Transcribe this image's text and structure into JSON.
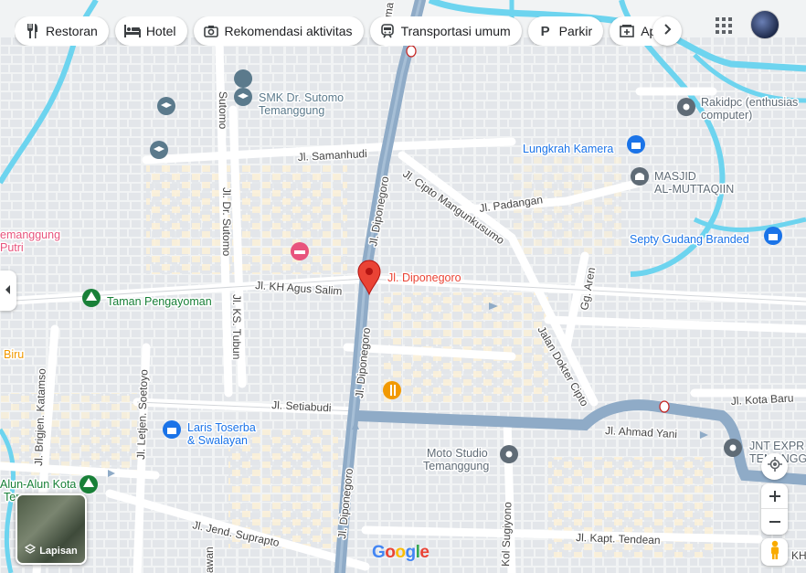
{
  "chips": [
    {
      "label": "Restoran",
      "icon": "fork-knife-icon"
    },
    {
      "label": "Hotel",
      "icon": "bed-icon"
    },
    {
      "label": "Rekomendasi aktivitas",
      "icon": "camera-icon"
    },
    {
      "label": "Transportasi umum",
      "icon": "train-icon"
    },
    {
      "label": "Parkir",
      "icon": "parking-icon"
    },
    {
      "label": "Apo",
      "icon": "pharmacy-icon"
    }
  ],
  "streets": {
    "ramaya": "Jl. Rama",
    "sutomo_top": "Sutomo",
    "samanhudi": "Jl. Samanhudi",
    "cipto_mangunkusumo": "Jl. Cipto Mangunkusumo",
    "padangan": "Jl. Padangan",
    "diponegoro_n": "Jl. Diponegoro",
    "dr_sutomo": "Jl. Dr. Sutomo",
    "kh_agus_salim": "Jl. KH Agus Salim",
    "ks_tubun": "Jl. KS. Tubun",
    "diponegoro_mid": "Jl. Diponegoro",
    "jalan_dokter_cipto": "Jalan Dokter Cipto",
    "gg_aren": "Gg. Aren",
    "brigjen_katamso": "Jl. Brigjen. Katamso",
    "letjen_soetoyo": "Jl. Letjen. Soetoyo",
    "setiabudi": "Jl. Setiabudi",
    "ahmad_yani": "Jl. Ahmad Yani",
    "kota_baru": "Jl. Kota Baru",
    "diponegoro_s": "Jl. Diponegoro",
    "kol_sugiyono": "Kol Sugiyono",
    "jend_suprapto": "Jl. Jend. Suprapto",
    "kapt_tendean": "Jl. Kapt. Tendean",
    "kh": "KH",
    "awan": "awan"
  },
  "pois": {
    "smk_sutomo_1": "SMK Dr. Sutomo",
    "smk_sutomo_2": "Temanggung",
    "rakidpc_1": "Rakidpc (enthusias",
    "rakidpc_2": "computer)",
    "lungkrah": "Lungkrah Kamera",
    "masjid_1": "MASJID",
    "masjid_2": "AL-MUTTAQIIN",
    "septy": "Septy Gudang Branded",
    "temanggung_left_1": "emanggung",
    "temanggung_left_2": "Putri",
    "taman": "Taman Pengayoman",
    "biru": "Biru",
    "selected_pin": "Jl. Diponegoro",
    "laris_1": "Laris Toserba",
    "laris_2": "& Swalayan",
    "moto_1": "Moto Studio",
    "moto_2": "Temanggung",
    "jnt_1": "JNT EXPR",
    "jnt_2": "TEMANGG",
    "alun_1": "Alun-Alun Kota",
    "alun_2": "Temanggung"
  },
  "layers_label": "Lapisan",
  "google_logo": "Google",
  "colors": {
    "main_road": "#8fabc7",
    "minor_road": "#ffffff",
    "river": "#6dd4ef",
    "building": "#e8eaed",
    "building_tan": "#fbefd5",
    "selected_pin": "#ea4335",
    "education_poi": "#5b7a8c",
    "shop_poi": "#1a73e8",
    "park_poi": "#188038",
    "food_poi": "#f29900",
    "lodging_poi": "#e8547d",
    "place_poi": "#5f6b76"
  }
}
